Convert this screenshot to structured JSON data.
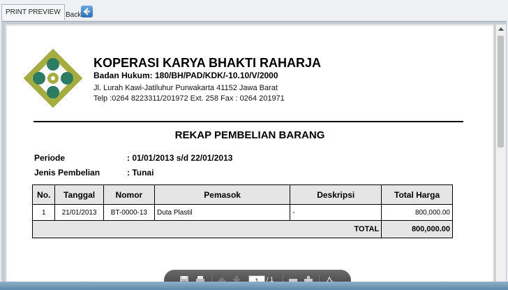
{
  "tabs": {
    "print_preview": "PRINT PREVIEW",
    "back": "Back"
  },
  "header": {
    "company": "KOPERASI KARYA BHAKTI RAHARJA",
    "badan_hukum": "Badan Hukum: 180/BH/PAD/KDK/-10.10/V/2000",
    "address": "Jl. Lurah Kawi-Jatiluhur Purwakarta 41152 Jawa Barat",
    "phone": "Telp :0264 8223311/201972 Ext. 258 Fax : 0264 201971"
  },
  "report": {
    "title": "REKAP PEMBELIAN BARANG",
    "period_label": "Periode",
    "period_value": ": 01/01/2013 s/d 22/01/2013",
    "type_label": "Jenis Pembelian",
    "type_value": ": Tunai"
  },
  "table": {
    "headers": [
      "No.",
      "Tanggal",
      "Nomor",
      "Pemasok",
      "Deskripsi",
      "Total Harga"
    ],
    "rows": [
      {
        "no": "1",
        "tanggal": "21/01/2013",
        "nomor": "BT-0000-13",
        "pemasok": "Duta Plastil",
        "deskripsi": "-",
        "total": "800,000.00"
      }
    ],
    "total_label": "TOTAL",
    "total_value": "800,000.00"
  },
  "pdf_toolbar": {
    "page_current": "1",
    "page_total": "/ 1",
    "icons": [
      "save-icon",
      "print-icon",
      "page-up-icon",
      "page-down-icon",
      "zoom-out-icon",
      "zoom-in-icon",
      "acrobat-icon"
    ]
  },
  "colors": {
    "logo_olive": "#a5ad3e",
    "logo_teal": "#2c7b63",
    "toolbar": "#4a4a4a"
  }
}
